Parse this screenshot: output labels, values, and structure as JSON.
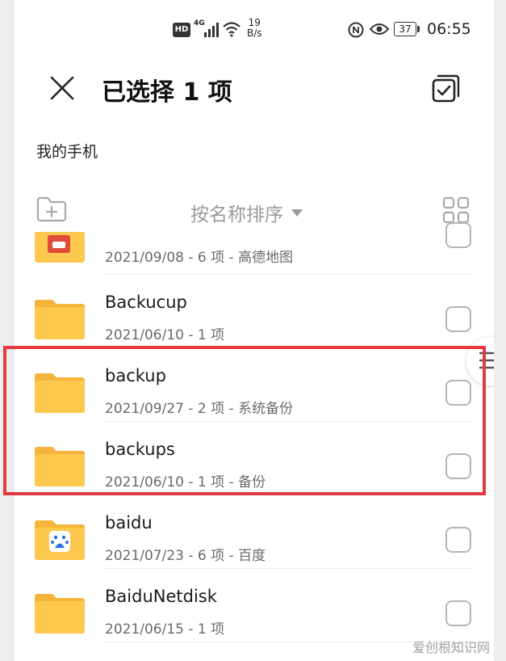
{
  "status_bar": {
    "hd": "HD",
    "network": "4G",
    "speed_value": "19",
    "speed_unit": "B/s",
    "battery": "37",
    "time": "06:55"
  },
  "header": {
    "title": "已选择 1 项",
    "breadcrumb": "我的手机"
  },
  "toolbar": {
    "sort_label": "按名称排序"
  },
  "files": [
    {
      "name": "",
      "meta": "2021/09/08 - 6 项 - 高德地图"
    },
    {
      "name": "Backucup",
      "meta": "2021/06/10 - 1 项"
    },
    {
      "name": "backup",
      "meta": "2021/09/27 - 2 项 - 系统备份"
    },
    {
      "name": "backups",
      "meta": "2021/06/10 - 1 项 - 备份"
    },
    {
      "name": "baidu",
      "meta": "2021/07/23 - 6 项 - 百度"
    },
    {
      "name": "BaiduNetdisk",
      "meta": "2021/06/15 - 1 项"
    }
  ],
  "watermark": "爱创根知识网",
  "colors": {
    "folder": "#fcc84d",
    "folder_tab": "#f5b43a",
    "highlight": "#e23a3f"
  }
}
